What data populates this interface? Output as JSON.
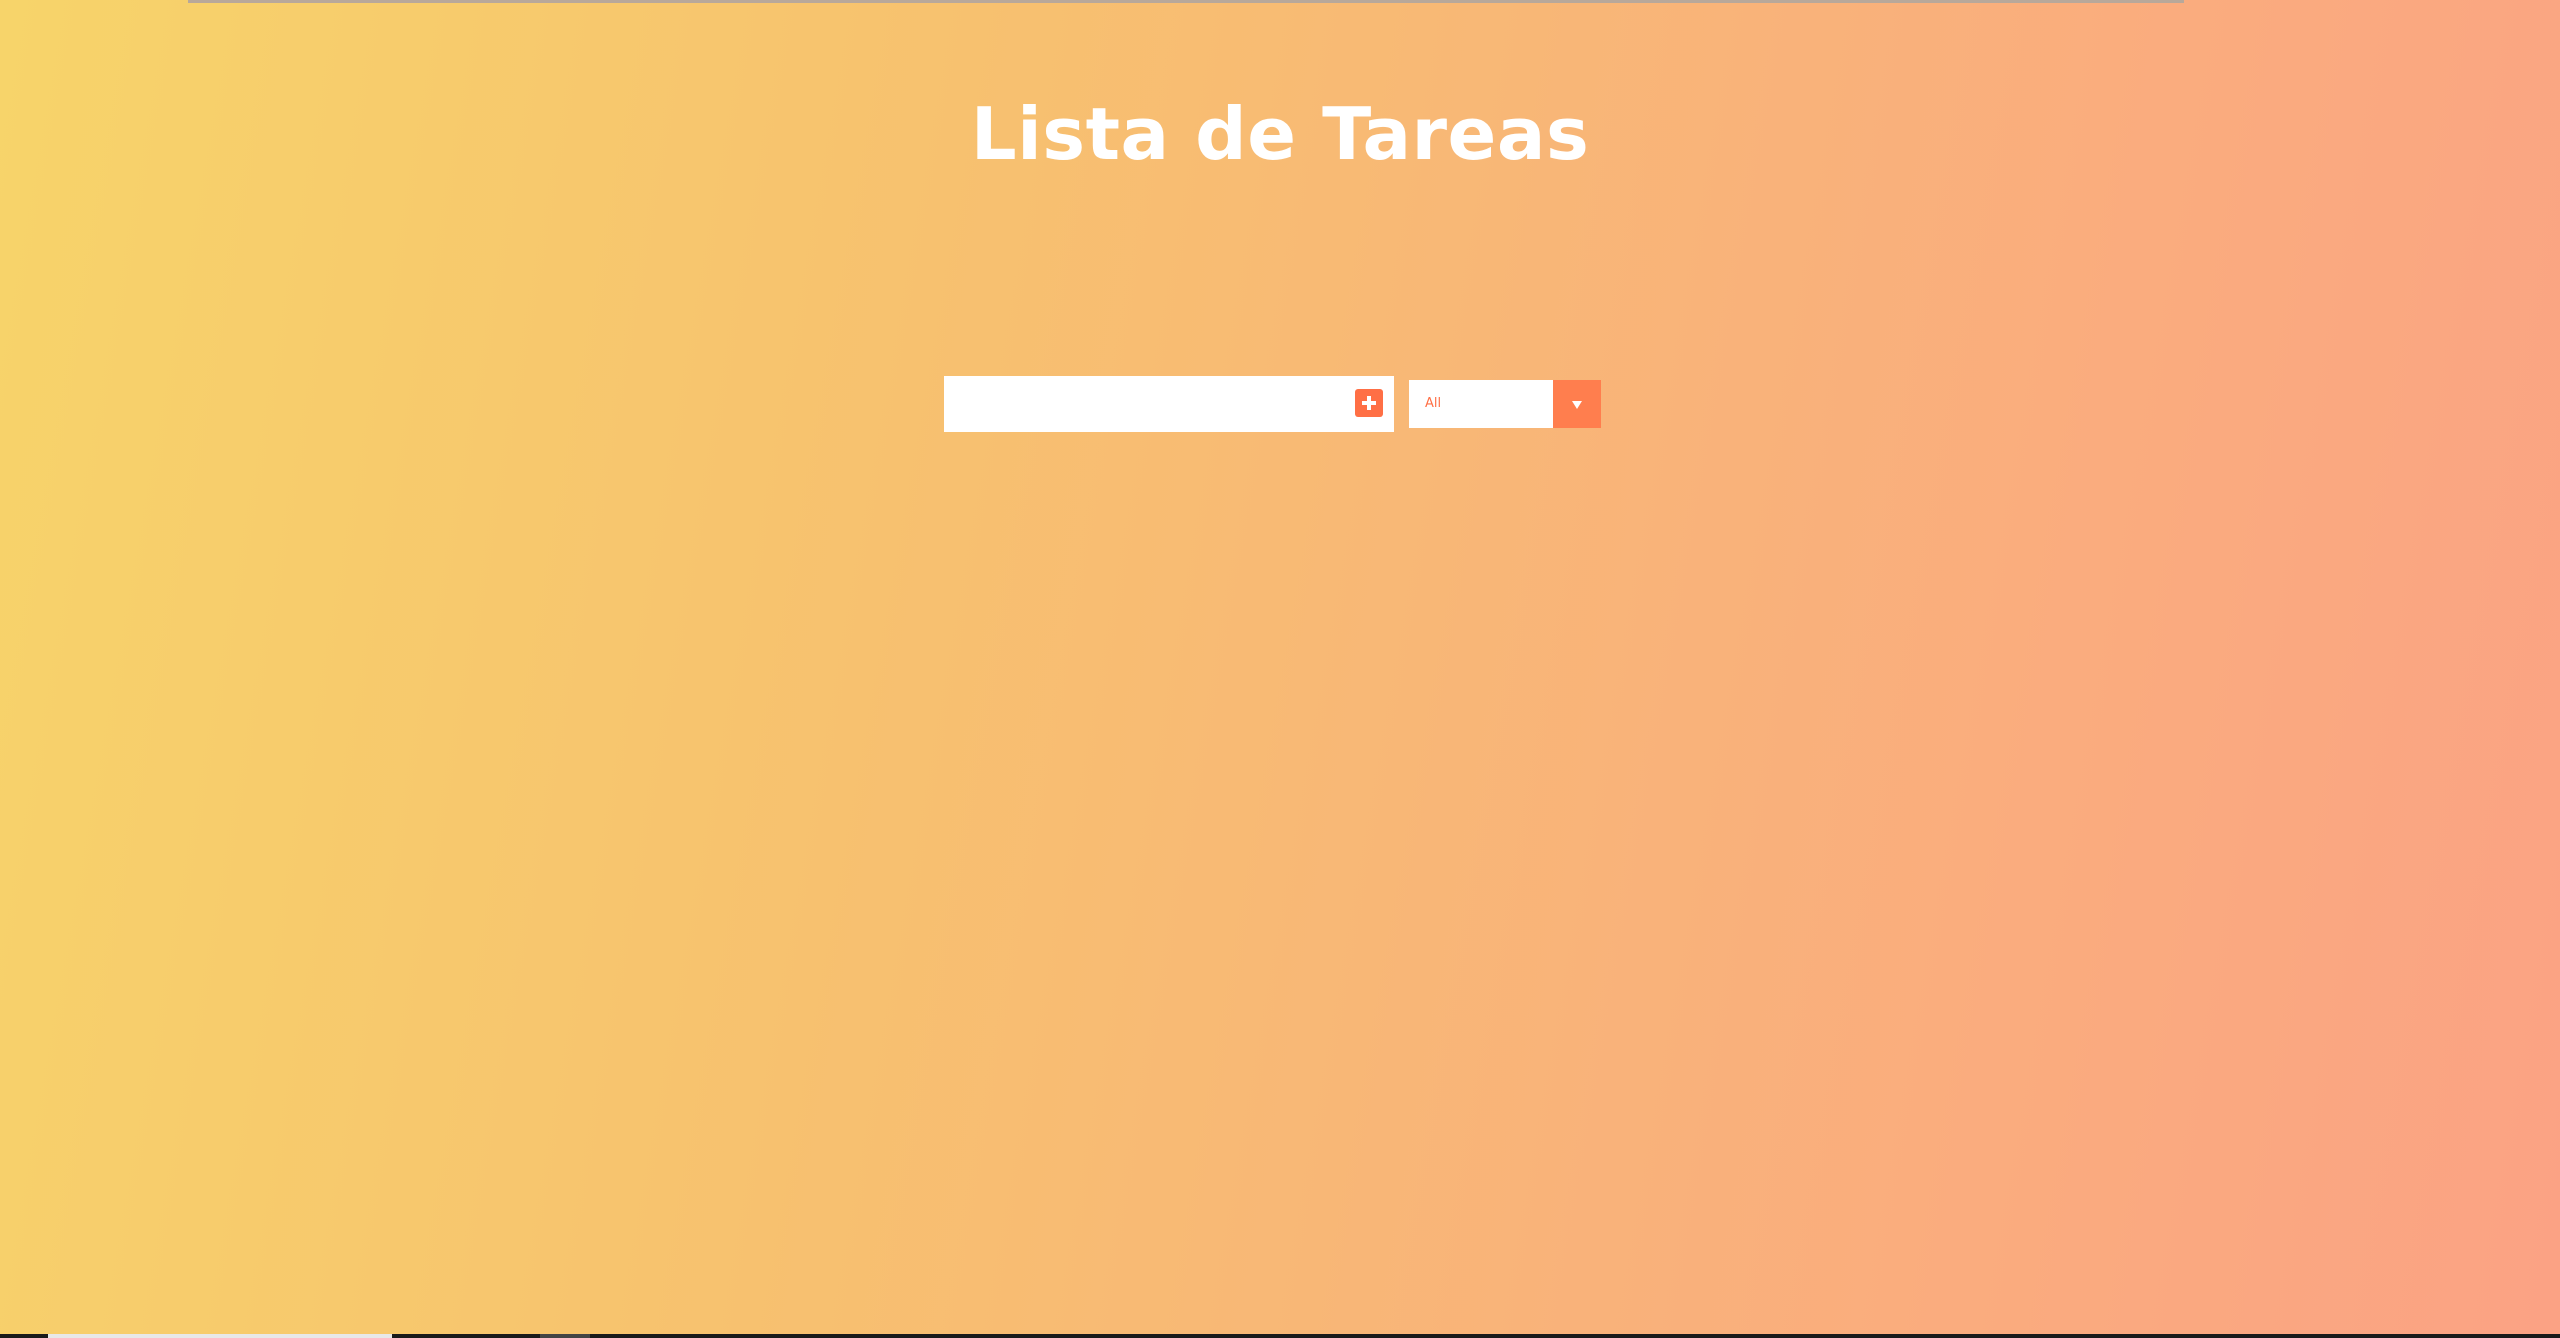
{
  "header": {
    "title": "Lista de Tareas"
  },
  "form": {
    "input_value": "",
    "add_button_icon": "plus-square-icon",
    "filter": {
      "selected": "All",
      "arrow_icon": "caret-down-icon"
    }
  },
  "colors": {
    "accent": "#ff6f45",
    "background_start": "#f7d46a",
    "background_end": "#fba284",
    "title": "#ffffff"
  }
}
